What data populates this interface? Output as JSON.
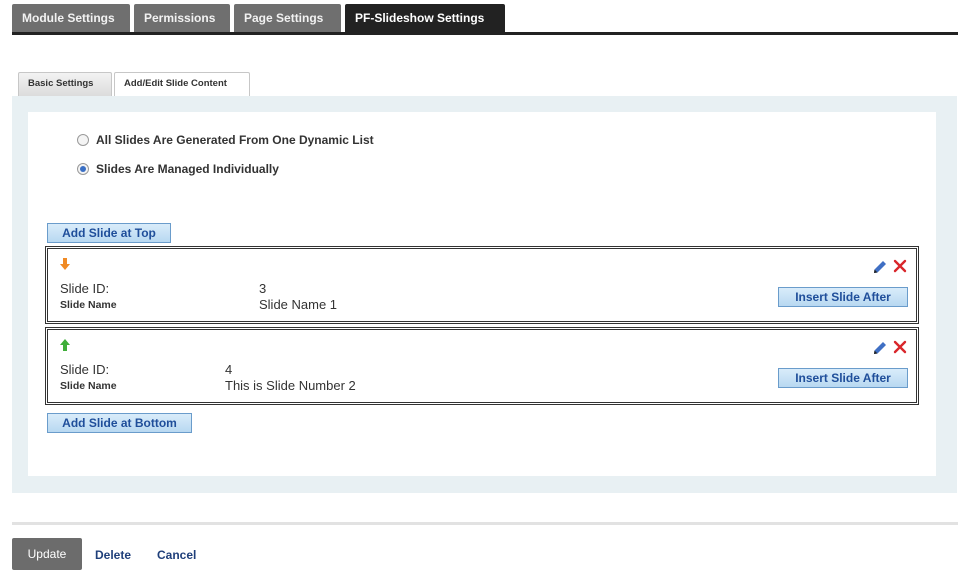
{
  "top_tabs": [
    {
      "label": "Module Settings"
    },
    {
      "label": "Permissions"
    },
    {
      "label": "Page Settings"
    },
    {
      "label": "PF-Slideshow Settings"
    }
  ],
  "sub_tabs": [
    {
      "label": "Basic Settings"
    },
    {
      "label": "Add/Edit Slide Content"
    }
  ],
  "mode_options": [
    {
      "label": "All Slides Are Generated From One Dynamic List",
      "selected": false
    },
    {
      "label": "Slides Are Managed Individually",
      "selected": true
    }
  ],
  "add_top_label": "Add Slide at Top",
  "add_bottom_label": "Add Slide at Bottom",
  "slide_id_label": "Slide ID:",
  "slide_name_label": "Slide Name",
  "insert_after_label": "Insert Slide After",
  "slides": [
    {
      "id": "3",
      "name": "Slide Name 1",
      "arrow": "arrow-down-icon"
    },
    {
      "id": "4",
      "name": "This is Slide Number 2",
      "arrow": "arrow-up-icon"
    }
  ],
  "actions": {
    "update": "Update",
    "delete": "Delete",
    "cancel": "Cancel"
  },
  "colors": {
    "accent_button_text": "#1f4e9a",
    "arrow_down": "#f08a24",
    "arrow_up": "#3fae3a",
    "delete_x": "#d9262b",
    "edit_pencil": "#3f6fc4"
  }
}
